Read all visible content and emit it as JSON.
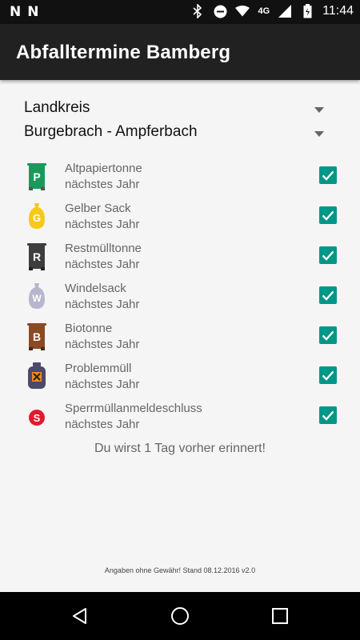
{
  "status_bar": {
    "left_icons": [
      "N",
      "N"
    ],
    "network": "4G",
    "time": "11:44"
  },
  "app": {
    "title": "Abfalltermine Bamberg"
  },
  "filters": {
    "region": "Landkreis",
    "location": "Burgebrach - Ampferbach"
  },
  "items": [
    {
      "name": "Altpapiertonne",
      "date": "nächstes Jahr",
      "icon_letter": "P",
      "icon_color": "#1a9a5a",
      "icon": "paper-bin-icon",
      "checked": true
    },
    {
      "name": "Gelber Sack",
      "date": "nächstes Jahr",
      "icon_letter": "G",
      "icon_color": "#f7c918",
      "icon": "yellow-sack-icon",
      "checked": true
    },
    {
      "name": "Restmülltonne",
      "date": "nächstes Jahr",
      "icon_letter": "R",
      "icon_color": "#3d3d3d",
      "icon": "residual-bin-icon",
      "checked": true
    },
    {
      "name": "Windelsack",
      "date": "nächstes Jahr",
      "icon_letter": "W",
      "icon_color": "#b8b6cf",
      "icon": "diaper-sack-icon",
      "checked": true
    },
    {
      "name": "Biotonne",
      "date": "nächstes Jahr",
      "icon_letter": "B",
      "icon_color": "#8a4a23",
      "icon": "organic-bin-icon",
      "checked": true
    },
    {
      "name": "Problemmüll",
      "date": "nächstes Jahr",
      "icon_letter": "",
      "icon_color": "#4a4a6a",
      "icon": "hazardous-waste-icon",
      "checked": true
    },
    {
      "name": "Sperrmüllanmeldeschluss",
      "date": "nächstes Jahr",
      "icon_letter": "S",
      "icon_color": "#e01b2d",
      "icon": "bulky-waste-icon",
      "checked": true
    }
  ],
  "reminder": "Du wirst 1 Tag vorher erinnert!",
  "footer": "Angaben ohne Gewähr! Stand 08.12.2016 v2.0",
  "colors": {
    "accent": "#009688",
    "appbar": "#212121"
  }
}
